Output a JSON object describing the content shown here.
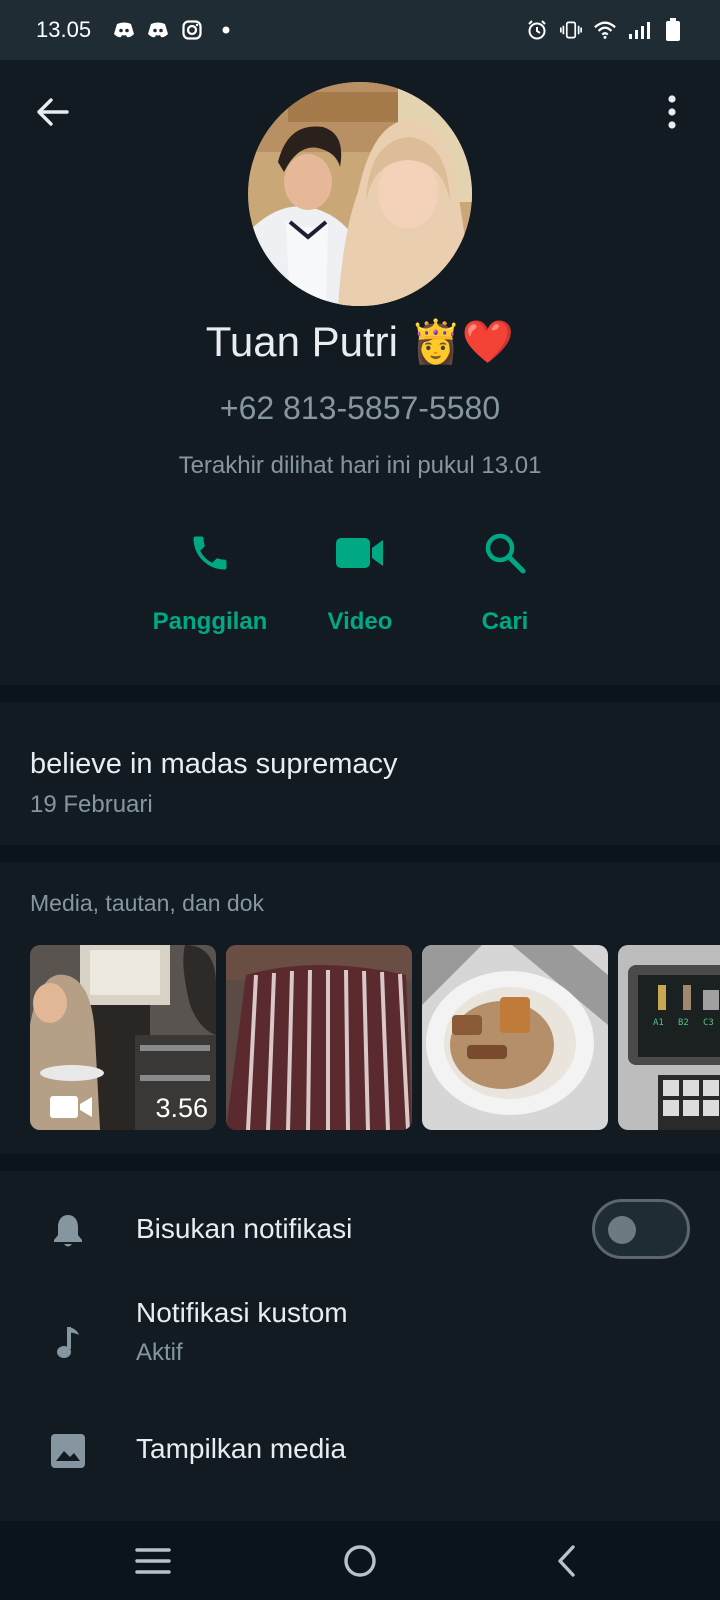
{
  "status_bar": {
    "time": "13.05",
    "left_icons": [
      "discord-icon",
      "discord-icon",
      "instagram-icon",
      "dot-icon"
    ],
    "right_icons": [
      "alarm-icon",
      "vibrate-icon",
      "wifi-icon",
      "signal-icon",
      "battery-icon"
    ]
  },
  "profile": {
    "name": "Tuan Putri 👸❤️",
    "phone": "+62 813-5857-5580",
    "last_seen": "Terakhir dilihat hari ini pukul 13.01"
  },
  "actions": [
    {
      "label": "Panggilan",
      "icon": "phone-icon"
    },
    {
      "label": "Video",
      "icon": "video-camera-icon"
    },
    {
      "label": "Cari",
      "icon": "search-icon"
    }
  ],
  "about": {
    "text": "believe in madas supremacy",
    "date": "19 Februari"
  },
  "media": {
    "title": "Media, tautan, dan dok",
    "items": [
      {
        "kind": "video",
        "duration": "3.56"
      },
      {
        "kind": "image"
      },
      {
        "kind": "image"
      },
      {
        "kind": "image"
      }
    ]
  },
  "settings": {
    "mute": {
      "label": "Bisukan notifikasi",
      "icon": "bell-icon",
      "enabled": false
    },
    "custom_notifications": {
      "label": "Notifikasi kustom",
      "sub": "Aktif",
      "icon": "music-note-icon"
    },
    "media_visibility": {
      "label": "Tampilkan media",
      "icon": "image-icon"
    }
  },
  "navbar": {
    "icons": [
      "recent-apps-icon",
      "home-icon",
      "back-icon"
    ]
  },
  "colors": {
    "accent": "#00a884",
    "background": "#121b22",
    "header": "#1f2c34",
    "divider": "#0b141a",
    "secondary_text": "#8696a0",
    "primary_text": "#e9edef"
  }
}
